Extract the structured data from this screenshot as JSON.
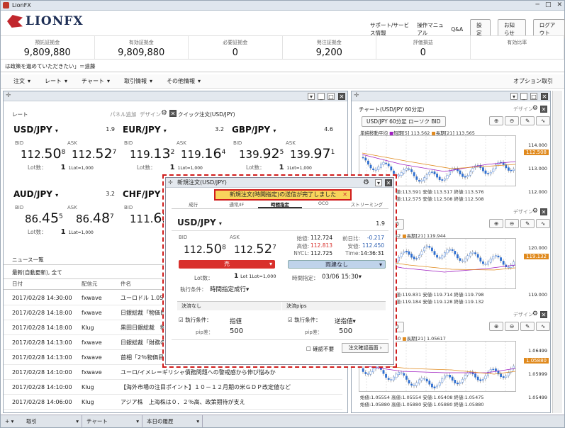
{
  "window": {
    "title": "LionFX",
    "controls": [
      "─",
      "□",
      "✕"
    ]
  },
  "brand": {
    "name": "LIONFX"
  },
  "toplinks": [
    "サポート/サービス情報",
    "操作マニュアル",
    "Q&A"
  ],
  "topbuttons": [
    "設定",
    "お知らせ",
    "ログアウト"
  ],
  "summary": [
    {
      "label": "預託証拠金",
      "value": "9,809,880"
    },
    {
      "label": "有効証拠金",
      "value": "9,809,880"
    },
    {
      "label": "必要証拠金",
      "value": "0"
    },
    {
      "label": "発注証拠金",
      "value": "9,200"
    },
    {
      "label": "評価損益",
      "value": "0"
    },
    {
      "label": "有効比率",
      "value": ""
    }
  ],
  "ticker": "は政策を進めていただきたい」＝遠藤",
  "menu": [
    "注文",
    "レート",
    "チャート",
    "取引情報",
    "その他情報"
  ],
  "menu_right": "オプション取引",
  "rate_panel": {
    "title": "レート",
    "add": "パネル追加",
    "design": "デザイン",
    "quick": "クイック注文(USD/JPY)",
    "rates": [
      {
        "pair": "USD/JPY",
        "spread": "1.9",
        "bid_a": "112.",
        "bid_b": "50",
        "bid_c": "8",
        "ask_a": "112.",
        "ask_b": "52",
        "ask_c": "7",
        "lot": "1",
        "lot_unit": "1Lot=1,000"
      },
      {
        "pair": "EUR/JPY",
        "spread": "3.2",
        "bid_a": "119.",
        "bid_b": "13",
        "bid_c": "2",
        "ask_a": "119.",
        "ask_b": "16",
        "ask_c": "4",
        "lot": "1",
        "lot_unit": "1Lot=1,000"
      },
      {
        "pair": "GBP/JPY",
        "spread": "4.6",
        "bid_a": "139.",
        "bid_b": "92",
        "bid_c": "5",
        "ask_a": "139.",
        "ask_b": "97",
        "ask_c": "1",
        "lot": "1",
        "lot_unit": "1Lot=1,000"
      },
      {
        "pair": "AUD/JPY",
        "spread": "3.2",
        "bid_a": "86.",
        "bid_b": "45",
        "bid_c": "5",
        "ask_a": "86.",
        "ask_b": "48",
        "ask_c": "7",
        "lot": "1",
        "lot_unit": "1Lot=1,000"
      },
      {
        "pair": "CHF/JPY",
        "spread": "",
        "bid_a": "111.",
        "bid_b": "62",
        "bid_c": "",
        "ask_a": "",
        "ask_b": "",
        "ask_c": "",
        "lot": "1",
        "lot_unit": "1Lot=1,000"
      }
    ],
    "bid": "BID",
    "ask": "ASK",
    "lotlabel": "Lot数："
  },
  "news": {
    "title": "ニュース一覧",
    "filter": "最新(自動更新), 全て",
    "cols": [
      "日付",
      "配信元",
      "件名"
    ],
    "rows": [
      {
        "date": "2017/02/28 14:30:00",
        "src": "fxwave",
        "title": "ユーロドル 1.05"
      },
      {
        "date": "2017/02/28 14:18:00",
        "src": "fxwave",
        "title": "日銀総裁「物価目"
      },
      {
        "date": "2017/02/28 14:18:00",
        "src": "Klug",
        "title": "黒田日銀総裁　物"
      },
      {
        "date": "2017/02/28 14:13:00",
        "src": "fxwave",
        "title": "日銀総裁「財務の"
      },
      {
        "date": "2017/02/28 14:13:00",
        "src": "fxwave",
        "title": "首相「2％物価目"
      },
      {
        "date": "2017/02/28 14:10:00",
        "src": "fxwave",
        "title": "ユーロ/イメレ＝ギリシャ債務問題への警戒感から伸び悩みか"
      },
      {
        "date": "2017/02/28 14:10:00",
        "src": "Klug",
        "title": "【海外市場の注目ポイント】１０－１２月期の米ＧＤＰ改定値など"
      },
      {
        "date": "2017/02/28 14:06:00",
        "src": "Klug",
        "title": "アジア株　上海株は０．２％高、政策期待が支え"
      }
    ]
  },
  "charts": [
    {
      "title": "チャート(USD/JPY 60分足)",
      "tab": "USD/JPY 60分足 ローソク BID",
      "design": "デザイン",
      "legend1": "単純移動平均",
      "legend2": "短期[5] 113.562",
      "legend3": "長期[21] 113.565",
      "ohlc": "始値:113.578 高値:113.591 安値:113.517 終値:113.576",
      "ohlc2": "始値:112.549 高値:112.575 安値:112.508 終値:112.508",
      "ticks": [
        "114.000",
        "113.000",
        "112.000"
      ],
      "xlabels": [
        "02/22 04:00",
        "16:00",
        "00:00",
        "02/25",
        "16:00",
        "00:00"
      ],
      "marker": "112.508",
      "ann1": "113.777",
      "ann2": "111.915",
      "ann3": "112.820"
    },
    {
      "title": "0分足)",
      "tab": "ローソク BID",
      "design": "デザイン",
      "legend2": "短期[5] 119.742",
      "legend3": "長期[21] 119.944",
      "ohlc": "始値:119.831 高値:119.831 安値:119.714 終値:119.798",
      "ohlc2": "始値:119.205 高値:119.184 安値:119.128 終値:119.132",
      "ticks": [
        "120.000",
        "119.000"
      ],
      "marker": "119.132",
      "ann1": "119.480",
      "ann2": "118.223"
    },
    {
      "title": "60分足)",
      "tab": "ローソク BID",
      "design": "デザイン",
      "legend2": "短期[5] 1.05440",
      "legend3": "長期[21] 1.05617",
      "ohlc": "始値:1.05554 高値:1.05554 安値:1.05408 終値:1.05475",
      "ohlc2": "始値:1.05880 高値:1.05880 安値:1.05880 終値:1.05880",
      "ticks": [
        "1.06499",
        "1.05999",
        "1.05499"
      ],
      "marker": "1.05880",
      "ann1": "1.06171",
      "ann2": "1.06286",
      "ann3": "1.05556",
      "ann4": "1.05005",
      "xlabel": "2017/02/22 04:00"
    }
  ],
  "dialog": {
    "title": "新規注文(USD/JPY)",
    "banner": "新規注文(時間指定)の送信が完了しました",
    "tabs": [
      "成行",
      "通常/IF",
      "時間指定",
      "OCO",
      "ストリーミング"
    ],
    "pair": "USD/JPY",
    "spread": "1.9",
    "bid": "BID",
    "ask": "ASK",
    "bid_a": "112.",
    "bid_b": "50",
    "bid_c": "8",
    "ask_a": "112.",
    "ask_b": "52",
    "ask_c": "7",
    "stats": [
      [
        "始値:",
        "112.724",
        "前日比:",
        "-0.217"
      ],
      [
        "高値:",
        "112.813",
        "安値:",
        "112.450"
      ],
      [
        "NYCL:",
        "112.725",
        "Time:",
        "14:36:31"
      ]
    ],
    "sell": "売",
    "buy": "両建なし",
    "lotlabel": "Lot数：",
    "lot": "1",
    "lot_unit": "Lot 1Lot=1,000",
    "time_label": "時間指定：",
    "time_value": "03/06 15:30",
    "exec_label": "執行条件：",
    "exec_value": "時間指定成行",
    "settle_l": "決済なし",
    "settle_r": "決済pips",
    "cond_label": "執行条件：",
    "cond_l": "指値",
    "cond_r": "逆指値",
    "pip_label": "pip差：",
    "pip_l": "500",
    "pip_r": "500",
    "confirm_label": "確認不要",
    "confirm_btn": "注文確認画面"
  },
  "bottom_tabs": [
    "取引",
    "チャート",
    "本日の履歴"
  ]
}
